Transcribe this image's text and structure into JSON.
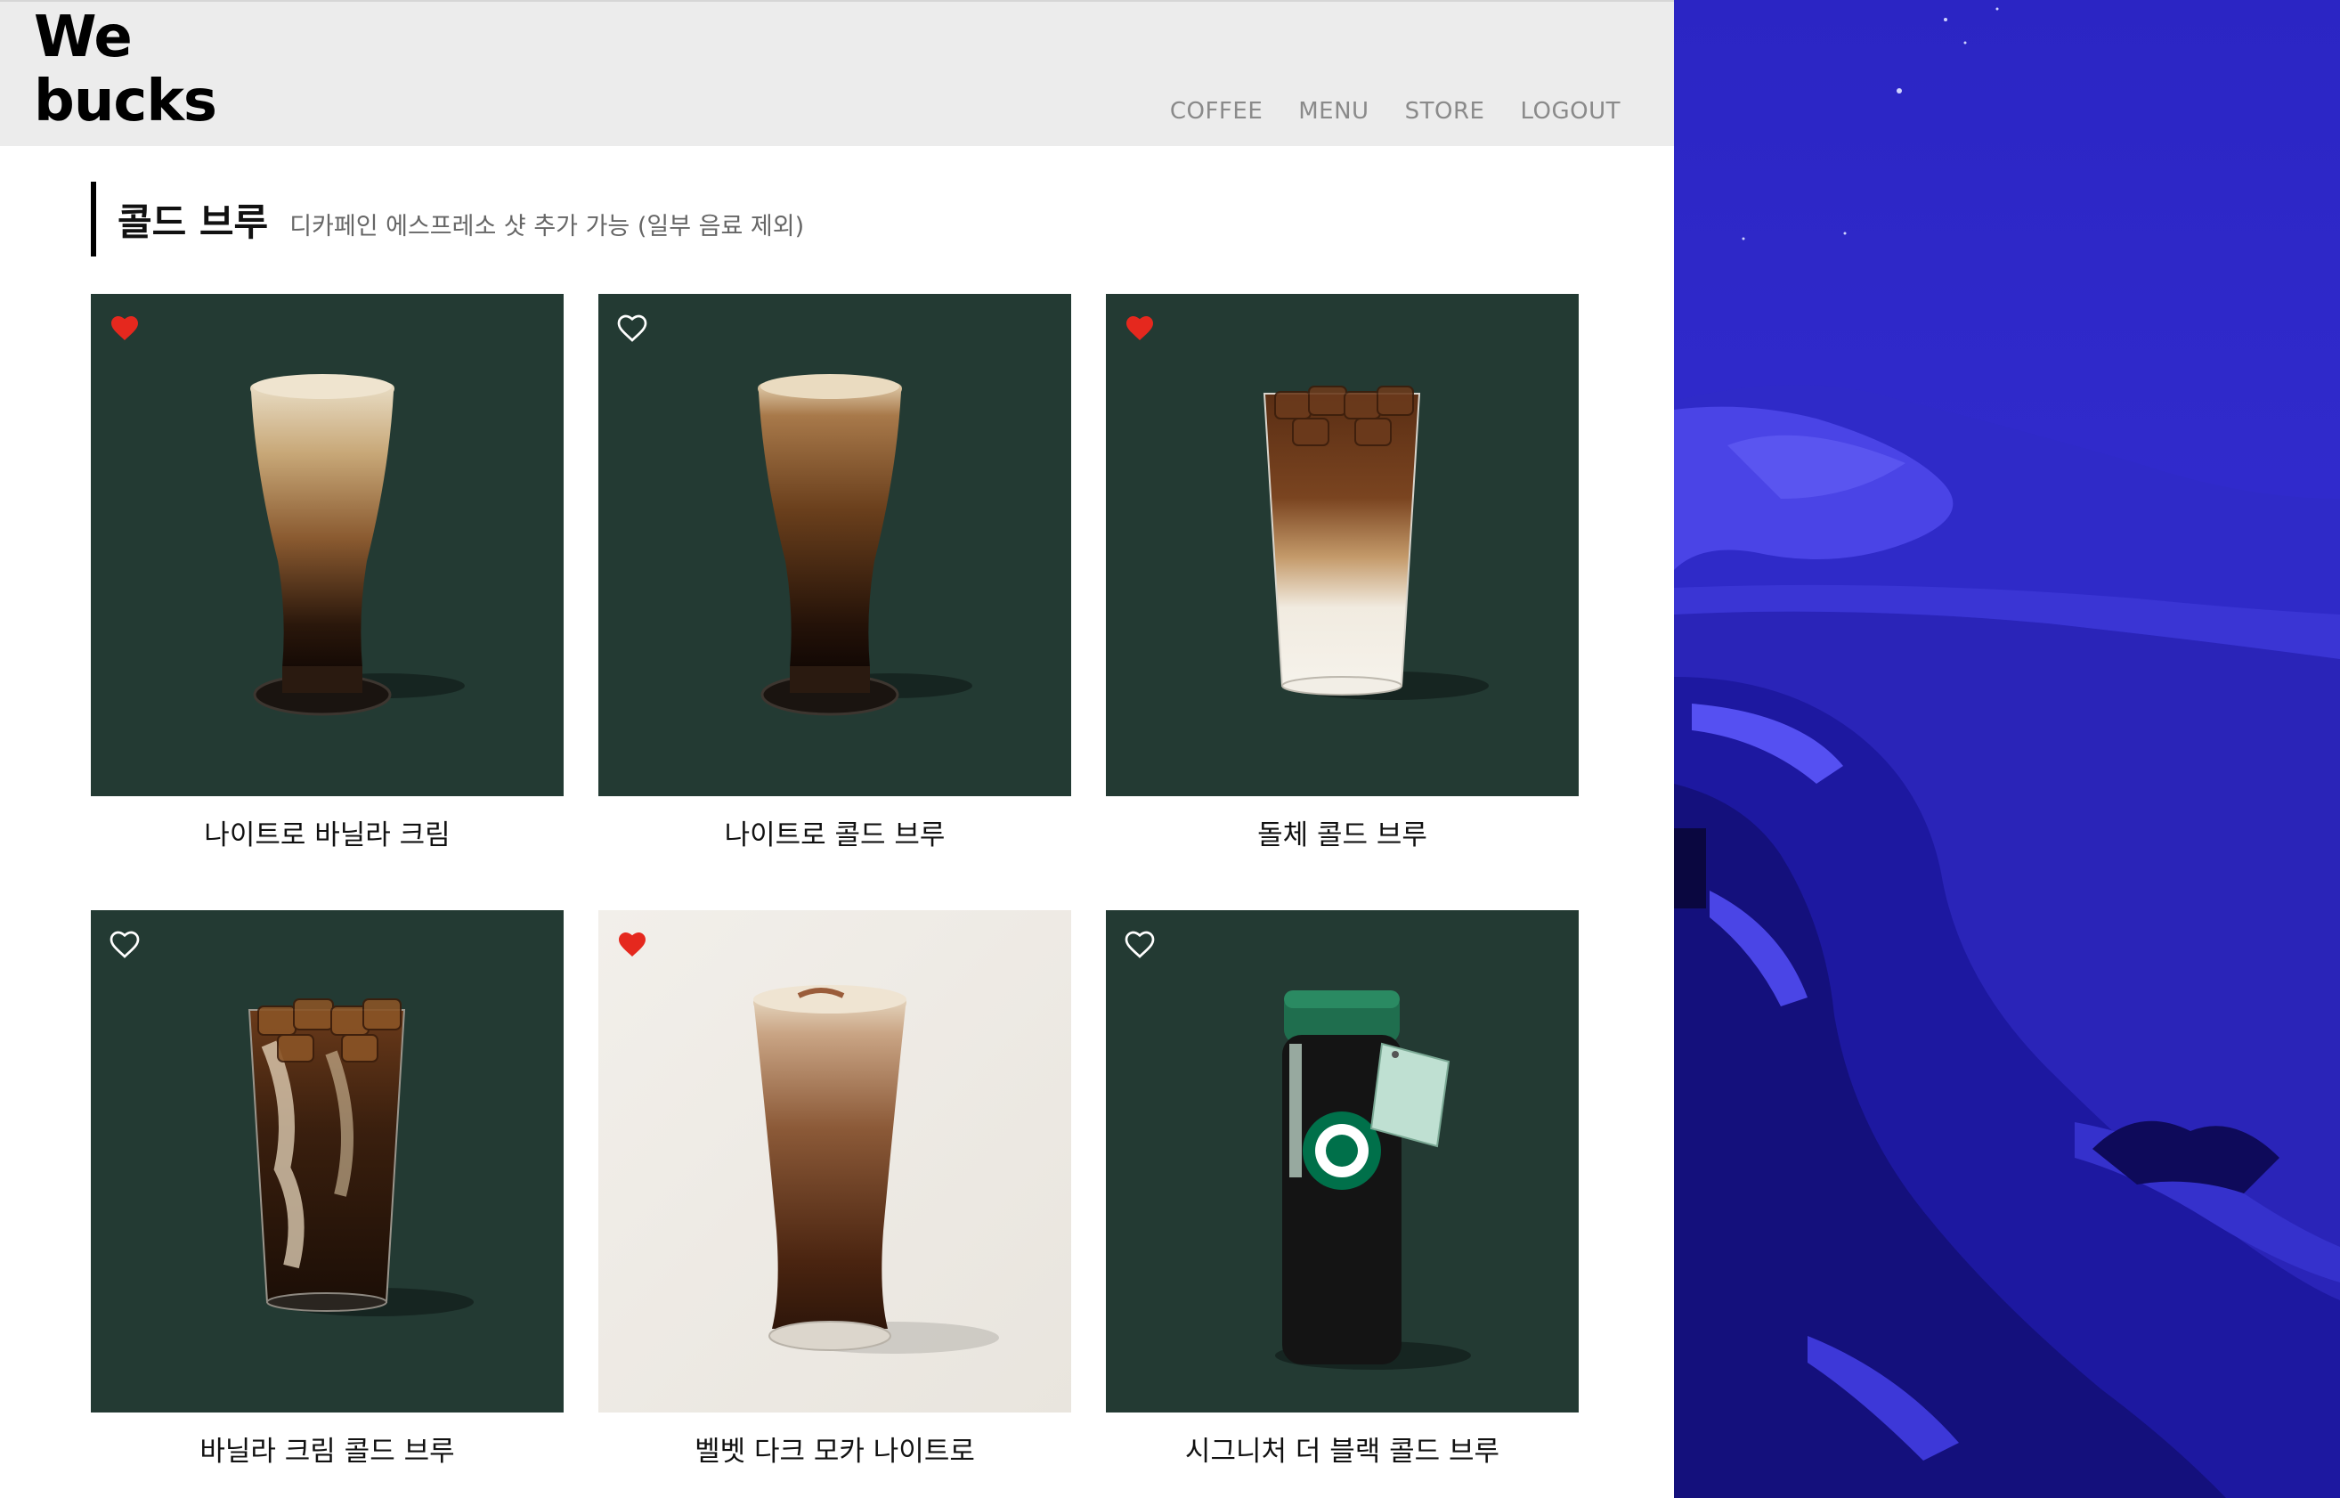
{
  "logo": {
    "line1": "We",
    "line2": "bucks"
  },
  "nav": [
    {
      "label": "COFFEE"
    },
    {
      "label": "MENU"
    },
    {
      "label": "STORE"
    },
    {
      "label": "LOGOUT"
    }
  ],
  "section": {
    "title": "콜드 브루",
    "subtitle": "디카페인 에스프레소 샷 추가 가능 (일부 음료 제외)"
  },
  "products": [
    {
      "name": "나이트로 바닐라 크림",
      "liked": true,
      "image": "nitro-vanilla-cream-glass"
    },
    {
      "name": "나이트로 콜드 브루",
      "liked": false,
      "image": "nitro-cold-brew-glass"
    },
    {
      "name": "돌체 콜드 브루",
      "liked": true,
      "image": "dolce-cold-brew-iced-glass"
    },
    {
      "name": "바닐라 크림 콜드 브루",
      "liked": false,
      "image": "vanilla-cream-cold-brew-iced-glass"
    },
    {
      "name": "벨벳 다크 모카 나이트로",
      "liked": true,
      "image": "velvet-dark-mocha-nitro-glass"
    },
    {
      "name": "시그니처 더 블랙 콜드 브루",
      "liked": false,
      "image": "signature-black-cold-brew-bottle"
    }
  ],
  "colors": {
    "header_bg": "#ececec",
    "card_bg": "#233a33",
    "heart_liked": "#e5281e",
    "heart_outline": "#ffffff",
    "nav_text": "#8a8a8a",
    "wallpaper": "#2a27c9"
  }
}
